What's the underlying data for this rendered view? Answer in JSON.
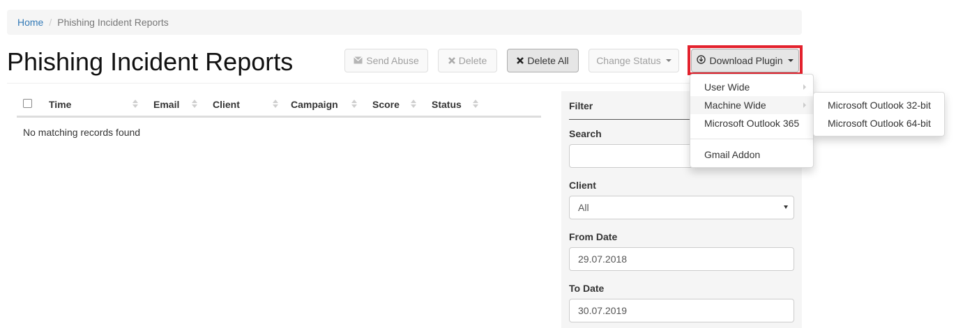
{
  "breadcrumb": {
    "home": "Home",
    "separator": "/",
    "current": "Phishing Incident Reports"
  },
  "page_title": "Phishing Incident Reports",
  "toolbar": {
    "send_abuse": {
      "icon": "envelope-icon",
      "label": "Send Abuse"
    },
    "delete": {
      "icon": "x-icon",
      "label": "Delete"
    },
    "delete_all": {
      "icon": "x-icon",
      "label": "Delete All"
    },
    "change_status": {
      "label": "Change Status"
    },
    "download_plugin": {
      "icon": "download-circle-icon",
      "label": "Download Plugin"
    }
  },
  "table": {
    "columns": [
      "Time",
      "Email",
      "Client",
      "Campaign",
      "Score",
      "Status"
    ],
    "empty_message": "No matching records found"
  },
  "filter": {
    "title": "Filter",
    "search_label": "Search",
    "search_value": "",
    "client_label": "Client",
    "client_value": "All",
    "from_label": "From Date",
    "from_value": "29.07.2018",
    "to_label": "To Date",
    "to_value": "30.07.2019"
  },
  "download_menu": {
    "items": [
      "User Wide",
      "Machine Wide",
      "Microsoft Outlook 365",
      "Gmail Addon"
    ],
    "submenu": [
      "Microsoft Outlook 32-bit",
      "Microsoft Outlook 64-bit"
    ]
  },
  "colors": {
    "link": "#337ab7",
    "highlight": "#e3222d",
    "panel": "#f5f5f5"
  }
}
